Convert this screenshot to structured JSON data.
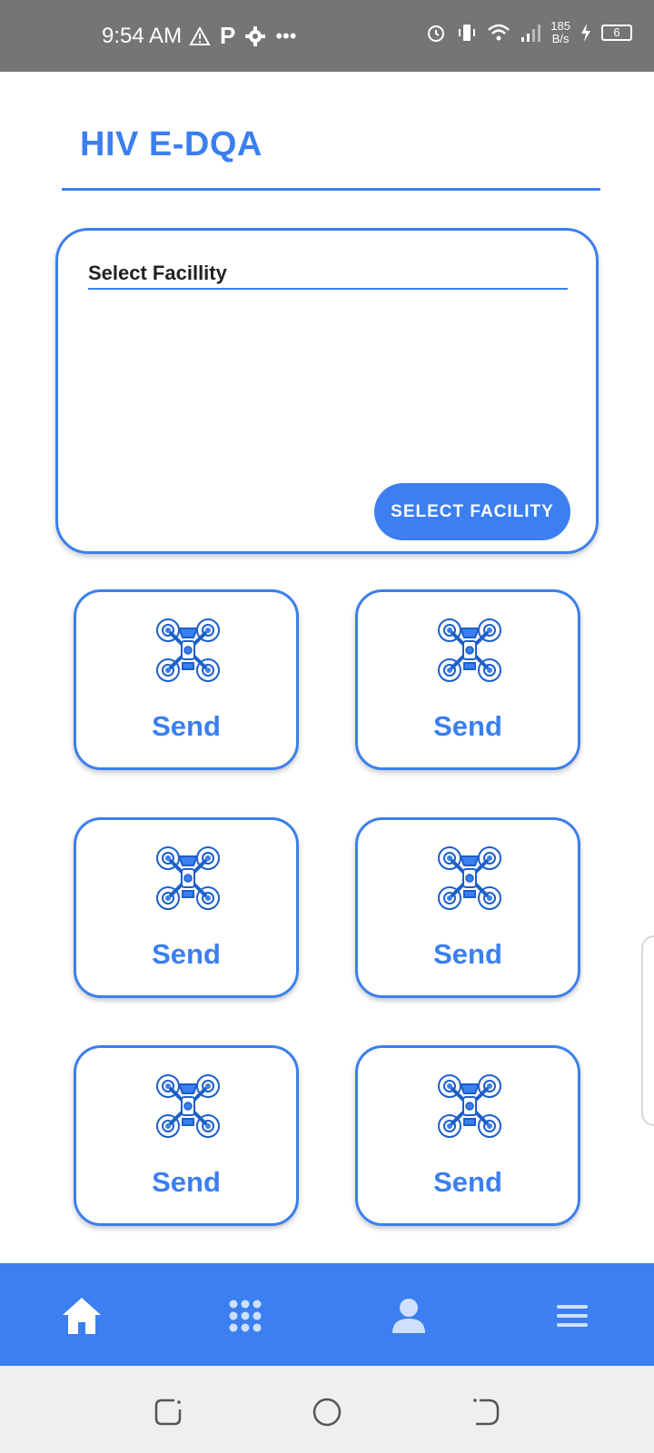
{
  "status_bar": {
    "time": "9:54 AM",
    "left_icons": [
      "warning-icon",
      "p-icon",
      "gear-icon",
      "more-dots-icon"
    ],
    "p_glyph": "P",
    "dots": "•••",
    "speed_value": "185",
    "speed_unit": "B/s",
    "battery_level": "6",
    "right_icons": [
      "alarm-icon",
      "vibrate-icon",
      "wifi-icon",
      "signal-icon",
      "charging-icon",
      "battery-icon"
    ]
  },
  "app": {
    "title": "HIV E-DQA"
  },
  "facility_card": {
    "label": "Select Facillity",
    "button_label": "SELECT FACILITY"
  },
  "tiles": [
    {
      "label": "Send",
      "icon": "drone-icon"
    },
    {
      "label": "Send",
      "icon": "drone-icon"
    },
    {
      "label": "Send",
      "icon": "drone-icon"
    },
    {
      "label": "Send",
      "icon": "drone-icon"
    },
    {
      "label": "Send",
      "icon": "drone-icon"
    },
    {
      "label": "Send",
      "icon": "drone-icon"
    }
  ],
  "bottom_nav": [
    {
      "icon": "home-icon"
    },
    {
      "icon": "apps-grid-icon"
    },
    {
      "icon": "person-icon"
    },
    {
      "icon": "menu-icon"
    }
  ],
  "system_nav": [
    "recents-icon",
    "home-circle-icon",
    "back-icon"
  ],
  "colors": {
    "accent": "#3b7ff0",
    "status_bar": "#757575",
    "system_nav": "#efefef"
  }
}
